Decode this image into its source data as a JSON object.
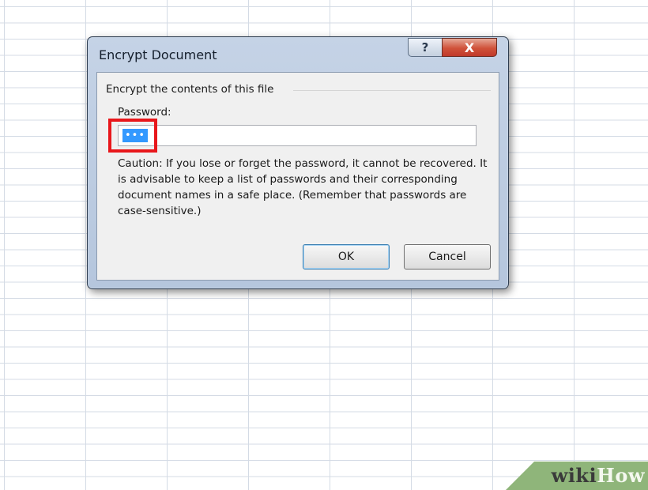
{
  "dialog": {
    "title": "Encrypt Document",
    "help_glyph": "?",
    "close_glyph": "X",
    "group_label": "Encrypt the contents of this file",
    "password_label": "Password:",
    "password_value": "•••",
    "caution_text": "Caution: If you lose or forget the password, it cannot be recovered. It is advisable to keep a list of passwords and their corresponding document names in a safe place. (Remember that passwords are case-sensitive.)",
    "ok_label": "OK",
    "cancel_label": "Cancel"
  },
  "watermark": {
    "part1": "wiki",
    "part2": "How"
  },
  "colors": {
    "highlight": "#e8171b",
    "selection": "#3399ff",
    "watermark_band": "#8fb57a"
  }
}
